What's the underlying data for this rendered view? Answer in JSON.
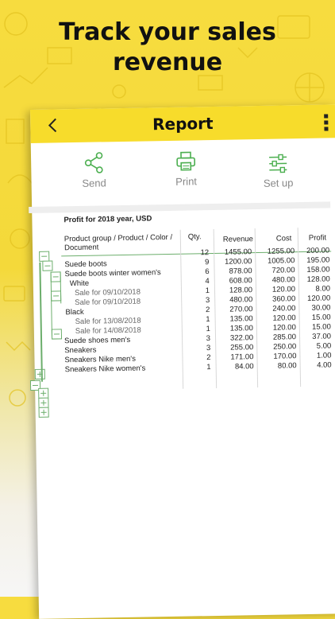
{
  "headline": [
    "Track your sales",
    "revenue"
  ],
  "appbar": {
    "title": "Report"
  },
  "toolbar": [
    {
      "label": "Send",
      "icon": "share-icon"
    },
    {
      "label": "Print",
      "icon": "printer-icon"
    },
    {
      "label": "Set up",
      "icon": "sliders-icon"
    }
  ],
  "colors": {
    "accent": "#f7dc2b",
    "icon_green": "#4caf50",
    "tree_green": "#6cae6c"
  },
  "report": {
    "title": "Profit for 2018 year, USD",
    "headers": {
      "product_line1": "Product group / Product / Color /",
      "product_line2": "Document",
      "qty": "Qty.",
      "revenue": "Revenue",
      "cost": "Cost",
      "profit": "Profit"
    },
    "rows": [
      {
        "label": "",
        "qty": "12",
        "revenue": "1455.00",
        "cost": "1255.00",
        "profit": "200.00"
      },
      {
        "label": "Suede boots",
        "qty": "9",
        "revenue": "1200.00",
        "cost": "1005.00",
        "profit": "195.00"
      },
      {
        "label": "Suede boots winter women's",
        "qty": "6",
        "revenue": "878.00",
        "cost": "720.00",
        "profit": "158.00"
      },
      {
        "label": "White",
        "qty": "4",
        "revenue": "608.00",
        "cost": "480.00",
        "profit": "128.00"
      },
      {
        "label": "Sale for 09/10/2018",
        "qty": "1",
        "revenue": "128.00",
        "cost": "120.00",
        "profit": "8.00"
      },
      {
        "label": "Sale for 09/10/2018",
        "qty": "3",
        "revenue": "480.00",
        "cost": "360.00",
        "profit": "120.00"
      },
      {
        "label": "Black",
        "qty": "2",
        "revenue": "270.00",
        "cost": "240.00",
        "profit": "30.00"
      },
      {
        "label": "Sale for 13/08/2018",
        "qty": "1",
        "revenue": "135.00",
        "cost": "120.00",
        "profit": "15.00"
      },
      {
        "label": "Sale for 14/08/2018",
        "qty": "1",
        "revenue": "135.00",
        "cost": "120.00",
        "profit": "15.00"
      },
      {
        "label": "Suede shoes men's",
        "qty": "3",
        "revenue": "322.00",
        "cost": "285.00",
        "profit": "37.00"
      },
      {
        "label": "Sneakers",
        "qty": "3",
        "revenue": "255.00",
        "cost": "250.00",
        "profit": "5.00"
      },
      {
        "label": "Sneakers Nike men's",
        "qty": "2",
        "revenue": "171.00",
        "cost": "170.00",
        "profit": "1.00"
      },
      {
        "label": "Sneakers Nike women's",
        "qty": "1",
        "revenue": "84.00",
        "cost": "80.00",
        "profit": "4.00"
      }
    ]
  }
}
